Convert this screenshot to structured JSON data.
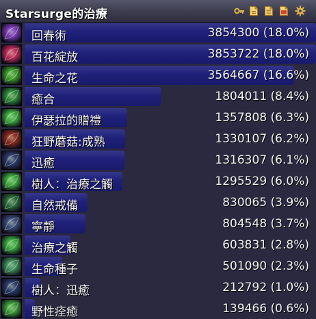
{
  "window": {
    "title": "Starsurge的治療",
    "buttons": [
      {
        "icon": "key-icon",
        "label": "reset"
      },
      {
        "icon": "document-icon",
        "label": "segment"
      },
      {
        "icon": "document-lines-icon",
        "label": "mode"
      },
      {
        "icon": "document-red-icon",
        "label": "report"
      },
      {
        "icon": "gear-icon",
        "label": "config"
      }
    ]
  },
  "colors": {
    "bar": "#1f207a",
    "title_bar": "#45455a",
    "button_gold": "#e0b24a",
    "button_red": "#d24436"
  },
  "rows": [
    {
      "name": "回春術",
      "value": "3854300 (18.0%)",
      "fraction": 1.0,
      "icon": "rejuvenation-icon",
      "icon_color": "#7a3ab8"
    },
    {
      "name": "百花綻放",
      "value": "3853722 (18.0%)",
      "fraction": 0.9998,
      "icon": "lifebloom-icon",
      "icon_color": "#c02a5a"
    },
    {
      "name": "生命之花",
      "value": "3564667 (16.6%)",
      "fraction": 0.925,
      "icon": "lifebloom-flower-icon",
      "icon_color": "#3a9a2a"
    },
    {
      "name": "癒合",
      "value": "1804011 (8.4%)",
      "fraction": 0.468,
      "icon": "regrowth-icon",
      "icon_color": "#2e8a3a"
    },
    {
      "name": "伊瑟拉的贈禮",
      "value": "1357808 (6.3%)",
      "fraction": 0.352,
      "icon": "ysera-gift-icon",
      "icon_color": "#3aa83e"
    },
    {
      "name": "狂野蘑菇:成熟",
      "value": "1330107 (6.2%)",
      "fraction": 0.345,
      "icon": "wild-mushroom-icon",
      "icon_color": "#8a2a1e"
    },
    {
      "name": "迅癒",
      "value": "1316307 (6.1%)",
      "fraction": 0.342,
      "icon": "swiftmend-icon",
      "icon_color": "#2a3a6a"
    },
    {
      "name": "樹人：治療之觸",
      "value": "1295529 (6.0%)",
      "fraction": 0.336,
      "icon": "treant-healing-touch-icon",
      "icon_color": "#3aa83e"
    },
    {
      "name": "自然戒備",
      "value": "830065 (3.9%)",
      "fraction": 0.215,
      "icon": "natures-vigil-icon",
      "icon_color": "#2a6a3a"
    },
    {
      "name": "寧靜",
      "value": "804548 (3.7%)",
      "fraction": 0.209,
      "icon": "tranquility-icon",
      "icon_color": "#3a4a7a"
    },
    {
      "name": "治療之觸",
      "value": "603831 (2.8%)",
      "fraction": 0.157,
      "icon": "healing-touch-icon",
      "icon_color": "#3aa83e"
    },
    {
      "name": "生命種子",
      "value": "501090 (2.3%)",
      "fraction": 0.13,
      "icon": "living-seed-icon",
      "icon_color": "#3a8a5a"
    },
    {
      "name": "樹人：迅癒",
      "value": "212792 (1.0%)",
      "fraction": 0.055,
      "icon": "treant-swiftmend-icon",
      "icon_color": "#2a3a6a"
    },
    {
      "name": "野性痊癒",
      "value": "139466 (0.6%)",
      "fraction": 0.036,
      "icon": "wild-growth-icon",
      "icon_color": "#3a9a3a"
    }
  ]
}
